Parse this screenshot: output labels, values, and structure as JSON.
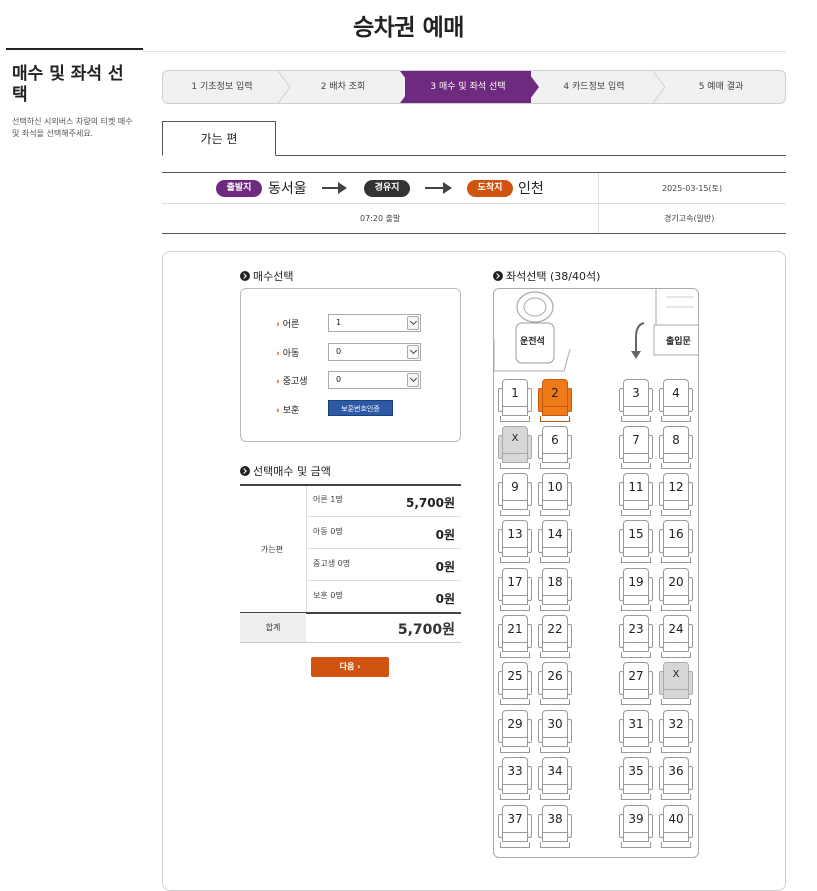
{
  "page": {
    "title": "승차권 예매"
  },
  "side": {
    "title": "매수 및 좌석 선택",
    "desc": "선택하신 시외버스 차량의 티켓 매수 및 좌석을 선택해주세요."
  },
  "steps": [
    "1 기초정보 입력",
    "2 배차 조회",
    "3 매수 및 좌석 선택",
    "4 카드정보 입력",
    "5 예매 결과"
  ],
  "active_step": 2,
  "tab": {
    "label": "가는 편"
  },
  "route": {
    "depart_badge": "출발지",
    "depart": "동서울",
    "via_badge": "경유지",
    "arrive_badge": "도착지",
    "arrive": "인천",
    "date": "2025-03-15(토)",
    "time": "07:20 출발",
    "company": "경기고속(일반)"
  },
  "count": {
    "title": "매수선택",
    "rows": [
      {
        "label": "어른",
        "value": "1"
      },
      {
        "label": "아동",
        "value": "0"
      },
      {
        "label": "중고생",
        "value": "0"
      }
    ],
    "voucher_label": "보훈",
    "voucher_button": "보훈번호인증"
  },
  "price": {
    "title": "선택매수 및 금액",
    "group": "가는편",
    "rows": [
      {
        "label": "어른 1명",
        "value": "5,700원"
      },
      {
        "label": "아동 0명",
        "value": "0원"
      },
      {
        "label": "중고생 0명",
        "value": "0원"
      },
      {
        "label": "보훈 0명",
        "value": "0원"
      }
    ],
    "total_label": "합계",
    "total_value": "5,700원",
    "next": "다음"
  },
  "seatmap": {
    "title": "좌석선택 (38/40석)",
    "driver": "운전석",
    "door": "출입문",
    "taken_mark": "X",
    "seats": [
      "1",
      "2",
      "3",
      "4",
      "X",
      "6",
      "7",
      "8",
      "9",
      "10",
      "11",
      "12",
      "13",
      "14",
      "15",
      "16",
      "17",
      "18",
      "19",
      "20",
      "21",
      "22",
      "23",
      "24",
      "25",
      "26",
      "27",
      "X",
      "29",
      "30",
      "31",
      "32",
      "33",
      "34",
      "35",
      "36",
      "37",
      "38",
      "39",
      "40"
    ],
    "selected": [
      "2"
    ],
    "taken_index": [
      4,
      27
    ]
  },
  "colors": {
    "active_step": "#6e2a7e",
    "selected_seat": "#f07a1a",
    "next_button": "#d05410",
    "depart_badge": "#6e2a7e",
    "via_badge": "#333333",
    "arrive_badge": "#d05410",
    "voucher_button": "#2d5aa6"
  }
}
